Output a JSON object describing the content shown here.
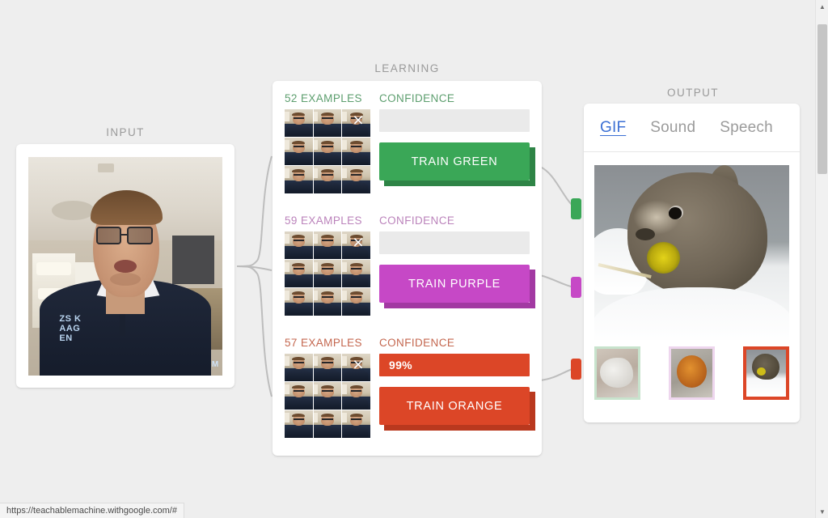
{
  "page": {
    "status_url": "https://teachablemachine.withgoogle.com/#"
  },
  "input": {
    "label": "INPUT"
  },
  "learning": {
    "label": "LEARNING",
    "classes": [
      {
        "id": "green",
        "examples_label": "52 EXAMPLES",
        "confidence_label": "CONFIDENCE",
        "confidence_value": "",
        "confidence_percent": 0,
        "train_label": "TRAIN GREEN",
        "color": "#3aa757",
        "color_dark": "#2e8446",
        "color_text": "#5c9e6e",
        "delete_icon": "×"
      },
      {
        "id": "purple",
        "examples_label": "59 EXAMPLES",
        "confidence_label": "CONFIDENCE",
        "confidence_value": "",
        "confidence_percent": 0,
        "train_label": "TRAIN PURPLE",
        "color": "#c648c6",
        "color_dark": "#a239a2",
        "color_text": "#bb83bb",
        "delete_icon": "×"
      },
      {
        "id": "orange",
        "examples_label": "57 EXAMPLES",
        "confidence_label": "CONFIDENCE",
        "confidence_value": "99%",
        "confidence_percent": 100,
        "train_label": "TRAIN ORANGE",
        "color": "#dc4627",
        "color_dark": "#b9381e",
        "color_text": "#c4674f",
        "delete_icon": "×"
      }
    ]
  },
  "output": {
    "label": "OUTPUT",
    "tabs": [
      {
        "label": "GIF",
        "active": true
      },
      {
        "label": "Sound",
        "active": false
      },
      {
        "label": "Speech",
        "active": false
      }
    ],
    "active_tab_color": "#3b6fd4",
    "thumbnails": [
      {
        "id": "thumb-green",
        "border_color": "#c8e3cd",
        "selected": false
      },
      {
        "id": "thumb-purple",
        "border_color": "#eed6ee",
        "selected": false
      },
      {
        "id": "thumb-orange",
        "border_color": "#dc4627",
        "selected": true
      }
    ]
  },
  "scrollbar": {
    "up_arrow": "▲",
    "down_arrow": "▼"
  }
}
